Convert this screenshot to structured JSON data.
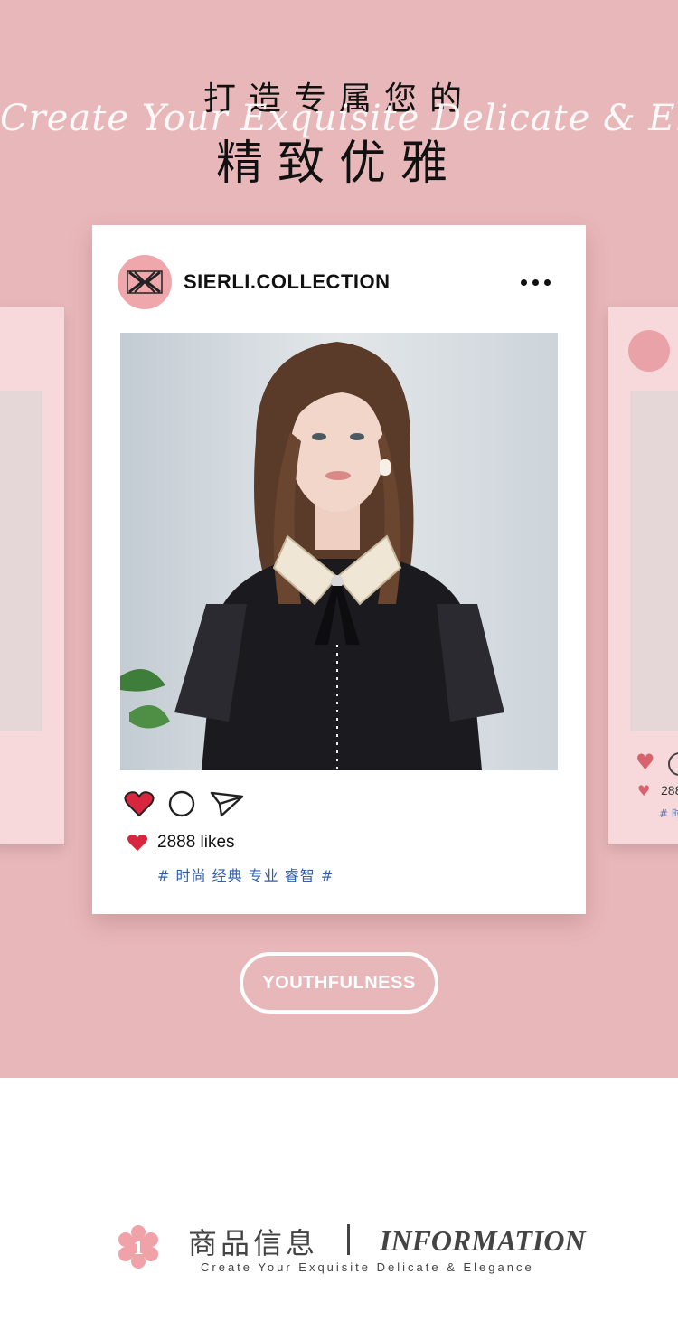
{
  "header": {
    "line1": "打造专属您的",
    "script": "Create Your Exquisite Delicate & Elegance",
    "line2": "精致优雅"
  },
  "post": {
    "username": "SIERLI.COLLECTION",
    "likes": "2888 likes",
    "tags": "# 时尚 经典 专业 睿智 #"
  },
  "side_card": {
    "likes_partial": "288",
    "tags_partial": "# 时"
  },
  "badge": {
    "label": "YOUTHFULNESS"
  },
  "info": {
    "number": "1",
    "title_cn": "商品信息",
    "title_en": "INFORMATION",
    "subtitle": "Create Your Exquisite Delicate & Elegance"
  },
  "icons": {
    "avatar": "sierli-logo-icon",
    "more": "more-dots-icon",
    "like": "heart-icon",
    "comment": "comment-circle-icon",
    "share": "paper-plane-icon"
  },
  "colors": {
    "background_pink": "#e8b7b9",
    "card_white": "#ffffff",
    "heart_red": "#d7263d",
    "tag_blue": "#2f5fae",
    "flower_pink": "#f0a2a8"
  }
}
